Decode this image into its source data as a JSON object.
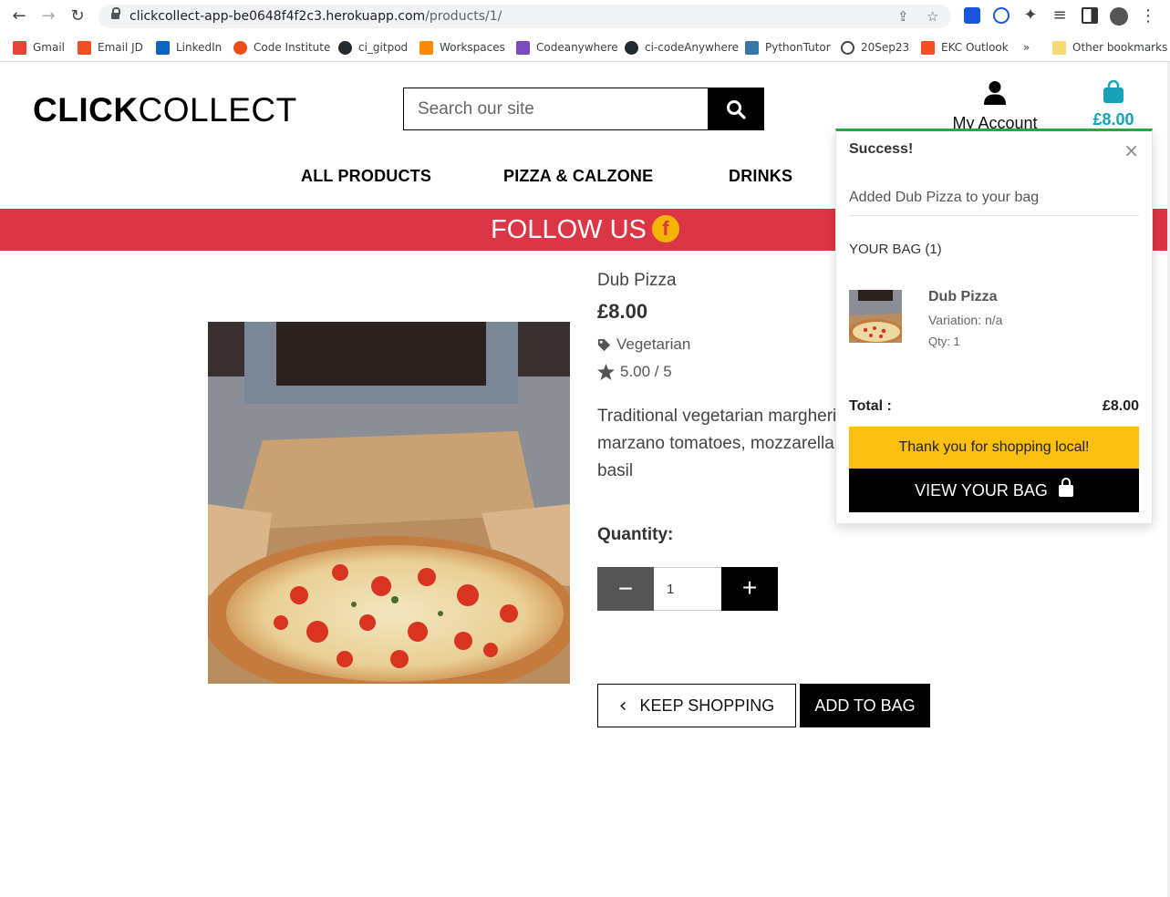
{
  "browser": {
    "url_host": "clickcollect-app-be0648f4f2c3.herokuapp.com",
    "url_path": "/products/1/",
    "bookmarks": [
      {
        "label": "Gmail",
        "color": "#ea4335"
      },
      {
        "label": "Email JD",
        "color": "#f25022"
      },
      {
        "label": "LinkedIn",
        "color": "#0a66c2"
      },
      {
        "label": "Code Institute",
        "color": "#e94e1b"
      },
      {
        "label": "ci_gitpod",
        "color": "#24292e"
      },
      {
        "label": "Workspaces",
        "color": "#ff8a00"
      },
      {
        "label": "Codeanywhere",
        "color": "#7b4cbf"
      },
      {
        "label": "ci-codeAnywhere",
        "color": "#24292e"
      },
      {
        "label": "PythonTutor",
        "color": "#3776ab"
      },
      {
        "label": "20Sep23",
        "color": "#444444"
      },
      {
        "label": "EKC Outlook",
        "color": "#f25022"
      }
    ],
    "overflow_label": "»",
    "other_bookmarks": "Other bookmarks"
  },
  "header": {
    "logo_bold": "CLICK",
    "logo_rest": "COLLECT",
    "search_placeholder": "Search our site",
    "account_label": "My Account",
    "bag_total": "£8.00"
  },
  "nav": {
    "items": [
      "ALL PRODUCTS",
      "PIZZA & CALZONE",
      "DRINKS"
    ]
  },
  "banner": {
    "text": "FOLLOW US",
    "icon": "facebook-icon"
  },
  "product": {
    "name": "Dub Pizza",
    "price": "£8.00",
    "category": "Vegetarian",
    "rating": "5.00 / 5",
    "description_lines": [
      "Traditional vegetarian margherita",
      "marzano tomatoes, mozzarella",
      "basil"
    ],
    "quantity_label": "Quantity:",
    "quantity_value": "1",
    "keep_shopping": "KEEP SHOPPING",
    "add_to_bag": "ADD TO BAG"
  },
  "toast": {
    "title": "Success!",
    "close": "×",
    "message": "Added Dub Pizza to your bag",
    "bag_heading": "YOUR BAG (1)",
    "item_name": "Dub Pizza",
    "item_variation": "Variation: n/a",
    "item_qty": "Qty: 1",
    "total_label": "Total :",
    "total_value": "£8.00",
    "local_message": "Thank you for shopping local!",
    "view_bag": "VIEW YOUR BAG",
    "accent_color": "#28a745"
  },
  "colors": {
    "banner": "#dc3545",
    "bag_accent": "#17a2b8",
    "cta_yellow": "#fbbf0f"
  }
}
